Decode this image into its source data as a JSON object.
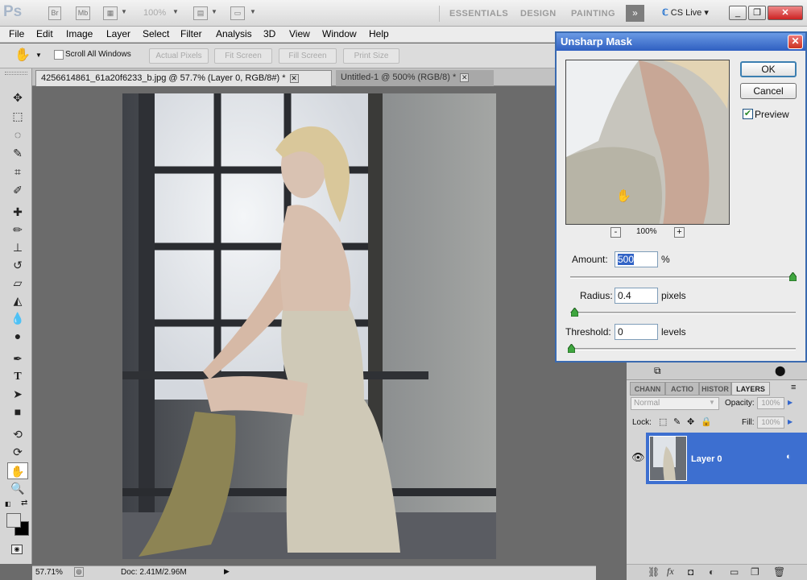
{
  "app": {
    "logo": "Ps",
    "icons": [
      "bridge-icon",
      "mini-bridge-icon",
      "view-extras-icon",
      "zoom-level-icon",
      "arrange-documents-icon",
      "screen-mode-icon"
    ],
    "zoom_display": "100%",
    "workspaces": [
      "ESSENTIALS",
      "DESIGN",
      "PAINTING"
    ],
    "more_workspaces": "»",
    "cs_live": "CS Live"
  },
  "menu": [
    "File",
    "Edit",
    "Image",
    "Layer",
    "Select",
    "Filter",
    "Analysis",
    "3D",
    "View",
    "Window",
    "Help"
  ],
  "options": {
    "scroll_all_windows": "Scroll All Windows",
    "buttons": [
      "Actual Pixels",
      "Fit Screen",
      "Fill Screen",
      "Print Size"
    ]
  },
  "tabs": [
    {
      "label": "4256614861_61a20f6233_b.jpg @ 57.7% (Layer 0, RGB/8#) *"
    },
    {
      "label": "Untitled-1 @ 500% (RGB/8) *"
    }
  ],
  "status": {
    "zoom": "57.71%",
    "doc": "Doc: 2.41M/2.96M"
  },
  "dialog": {
    "title": "Unsharp Mask",
    "ok": "OK",
    "cancel": "Cancel",
    "preview_label": "Preview",
    "preview_checked": true,
    "zoom_minus": "-",
    "zoom_plus": "+",
    "zoom_pct": "100%",
    "amount": {
      "label": "Amount:",
      "value": "500",
      "unit": "%"
    },
    "radius": {
      "label": "Radius:",
      "value": "0.4",
      "unit": "pixels"
    },
    "threshold": {
      "label": "Threshold:",
      "value": "0",
      "unit": "levels"
    }
  },
  "layers_panel": {
    "tabs": [
      "CHANN",
      "ACTIO",
      "HISTOR",
      "LAYERS"
    ],
    "blend_mode": "Normal",
    "opacity_label": "Opacity:",
    "opacity_value": "100%",
    "lock_label": "Lock:",
    "fill_label": "Fill:",
    "fill_value": "100%",
    "layer_name": "Layer 0"
  }
}
